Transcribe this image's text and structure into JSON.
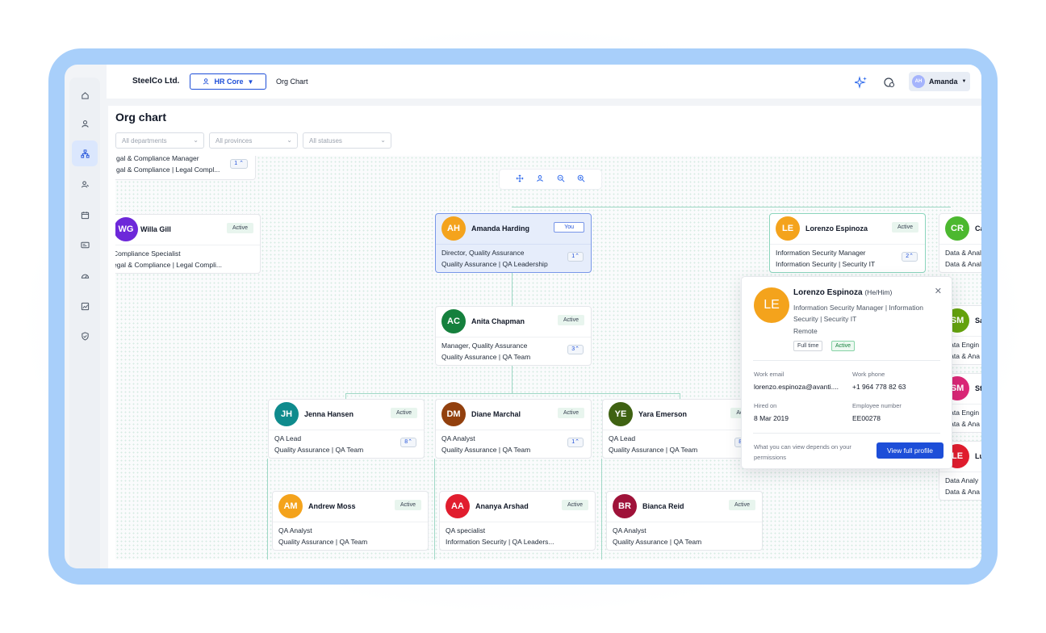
{
  "topbar": {
    "brand": "SteelCo Ltd.",
    "module": "HR Core",
    "breadcrumb": "Org Chart",
    "user": {
      "initials": "AH",
      "name": "Amanda"
    }
  },
  "page": {
    "title": "Org chart"
  },
  "filters": {
    "departments": "All departments",
    "provinces": "All provinces",
    "statuses": "All statuses"
  },
  "cards": {
    "top_partial": {
      "title": "gal & Compliance Manager",
      "dept": "gal & Compliance | Legal Compl...",
      "count": "1"
    },
    "willa": {
      "initials": "WG",
      "name": "Willa Gill",
      "status": "Active",
      "title": "Compliance Specialist",
      "dept": "egal & Compliance | Legal Compli..."
    },
    "amanda": {
      "initials": "AH",
      "name": "Amanda Harding",
      "status": "You",
      "title": "Director, Quality Assurance",
      "dept": "Quality Assurance | QA Leadership",
      "count": "1"
    },
    "lorenzo": {
      "initials": "LE",
      "name": "Lorenzo Espinoza",
      "status": "Active",
      "title": "Information Security Manager",
      "dept": "Information Security | Security IT",
      "count": "2"
    },
    "anita": {
      "initials": "AC",
      "name": "Anita Chapman",
      "status": "Active",
      "title": "Manager, Quality Assurance",
      "dept": "Quality Assurance | QA Team",
      "count": "3"
    },
    "jenna": {
      "initials": "JH",
      "name": "Jenna Hansen",
      "status": "Active",
      "title": "QA Lead",
      "dept": "Quality Assurance | QA Team",
      "count": "8"
    },
    "diane": {
      "initials": "DM",
      "name": "Diane Marchal",
      "status": "Active",
      "title": "QA Analyst",
      "dept": "Quality Assurance | QA Team",
      "count": "1"
    },
    "yara": {
      "initials": "YE",
      "name": "Yara Emerson",
      "status": "Acti",
      "title": "QA Lead",
      "dept": "Quality Assurance | QA Team",
      "count": "8"
    },
    "andrew": {
      "initials": "AM",
      "name": "Andrew Moss",
      "status": "Active",
      "title": "QA Analyst",
      "dept": "Quality Assurance | QA Team"
    },
    "ananya": {
      "initials": "AA",
      "name": "Ananya Arshad",
      "status": "Active",
      "title": "QA specialist",
      "dept": "Information Security | QA Leaders..."
    },
    "bianca": {
      "initials": "BR",
      "name": "Bianca Reid",
      "status": "Active",
      "title": "QA Analyst",
      "dept": "Quality Assurance | QA Team"
    },
    "right_cr": {
      "initials": "CR",
      "name": "Ca",
      "title": "Data & Anal",
      "dept": "Data & Anal"
    },
    "right_sm1": {
      "initials": "SM",
      "name": "Sa",
      "title": "Data Engin",
      "dept": "Data & Ana"
    },
    "right_sm2": {
      "initials": "SM",
      "name": "St",
      "title": "Data Engin",
      "dept": "Data & Ana"
    },
    "right_le": {
      "initials": "LE",
      "name": "Lu",
      "title": "Data Analy",
      "dept": "Data & Ana"
    }
  },
  "popup": {
    "initials": "LE",
    "name": "Lorenzo Espinoza",
    "pronouns": "(He/Him)",
    "role_line": "Information Security Manager | Information Security | Security IT",
    "location": "Remote",
    "tags": [
      "Full time",
      "Active"
    ],
    "work_email_label": "Work email",
    "work_email": "lorenzo.espinoza@avanti....",
    "work_phone_label": "Work phone",
    "work_phone": "+1 964 778 82 63",
    "hired_label": "Hired on",
    "hired": "8 Mar 2019",
    "employee_number_label": "Employee number",
    "employee_number": "EE00278",
    "permission_note": "What you can view depends on your permissions",
    "view_button": "View full profile"
  },
  "colors": {
    "accent": "#1d4ed8",
    "frame": "#a8cffa",
    "connector": "#9fd8c6",
    "active_badge": "#e8f5ee",
    "avatar_AH": "#f4a31c",
    "avatar_WG": "#6d28d9",
    "avatar_LE": "#f4a31c",
    "avatar_AC": "#15803d",
    "avatar_JH": "#0f8b8d",
    "avatar_DM": "#92400e",
    "avatar_YE": "#3f6212",
    "avatar_AM": "#f4a31c",
    "avatar_AA": "#e11d2e",
    "avatar_BR": "#9f1239",
    "avatar_CR": "#4cb82f",
    "avatar_SM1": "#65a30d",
    "avatar_SM2": "#db2777",
    "avatar_LE2": "#e11d2e"
  }
}
